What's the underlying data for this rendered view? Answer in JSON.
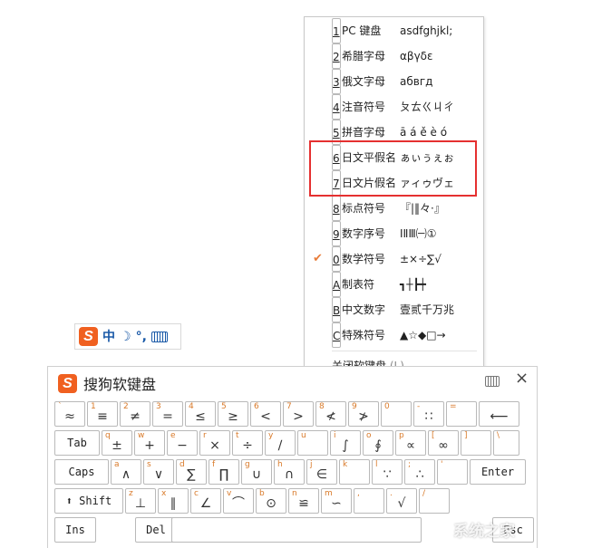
{
  "menu": {
    "items": [
      {
        "key": "1",
        "label": "PC 键盘",
        "sample": "asdfghjkl;",
        "checked": false
      },
      {
        "key": "2",
        "label": "希腊字母",
        "sample": "αβγδε",
        "checked": false
      },
      {
        "key": "3",
        "label": "俄文字母",
        "sample": "абвгд",
        "checked": false
      },
      {
        "key": "4",
        "label": "注音符号",
        "sample": "ㄆㄊㄍㄐㄔ",
        "checked": false
      },
      {
        "key": "5",
        "label": "拼音字母",
        "sample": "ā á ě è ó",
        "checked": false
      },
      {
        "key": "6",
        "label": "日文平假名",
        "sample": "ぁぃぅぇぉ",
        "checked": false
      },
      {
        "key": "7",
        "label": "日文片假名",
        "sample": "ァィゥヴェ",
        "checked": false
      },
      {
        "key": "8",
        "label": "标点符号",
        "sample": "『|‖々·』",
        "checked": false
      },
      {
        "key": "9",
        "label": "数字序号",
        "sample": "ⅠⅡⅢ㈠①",
        "checked": false
      },
      {
        "key": "0",
        "label": "数学符号",
        "sample": "±×÷∑√",
        "checked": true
      },
      {
        "key": "A",
        "label": "制表符",
        "sample": "┓┼┣┿",
        "checked": false
      },
      {
        "key": "B",
        "label": "中文数字",
        "sample": "壹贰千万兆",
        "checked": false
      },
      {
        "key": "C",
        "label": "特殊符号",
        "sample": "▲☆◆□→",
        "checked": false
      }
    ],
    "close_label": "关闭软键盘",
    "close_shortcut": "(L)",
    "check_mark": "✔"
  },
  "status_bar": {
    "logo": "S",
    "mode": "中",
    "moon": "☽",
    "punct": "°,"
  },
  "keyboard": {
    "logo": "S",
    "title": "搜狗软键盘",
    "close": "×",
    "rows": [
      [
        {
          "u": "`",
          "m": "≈"
        },
        {
          "u": "1",
          "m": "≡"
        },
        {
          "u": "2",
          "m": "≠"
        },
        {
          "u": "3",
          "m": "="
        },
        {
          "u": "4",
          "m": "≤"
        },
        {
          "u": "5",
          "m": "≥"
        },
        {
          "u": "6",
          "m": "<"
        },
        {
          "u": "7",
          "m": ">"
        },
        {
          "u": "8",
          "m": "≮"
        },
        {
          "u": "9",
          "m": "≯"
        },
        {
          "u": "0",
          "m": ""
        },
        {
          "u": "-",
          "m": "∷"
        },
        {
          "u": "=",
          "m": ""
        },
        {
          "u": "",
          "m": "⟵"
        }
      ],
      [
        {
          "u": "",
          "m": "Tab",
          "lbl": true
        },
        {
          "u": "q",
          "m": "±"
        },
        {
          "u": "w",
          "m": "+"
        },
        {
          "u": "e",
          "m": "−"
        },
        {
          "u": "r",
          "m": "×"
        },
        {
          "u": "t",
          "m": "÷"
        },
        {
          "u": "y",
          "m": "∕"
        },
        {
          "u": "u",
          "m": ""
        },
        {
          "u": "i",
          "m": "∫"
        },
        {
          "u": "o",
          "m": "∮"
        },
        {
          "u": "p",
          "m": "∝"
        },
        {
          "u": "[",
          "m": "∞"
        },
        {
          "u": "]",
          "m": ""
        },
        {
          "u": "\\",
          "m": ""
        }
      ],
      [
        {
          "u": "",
          "m": "Caps",
          "lbl": true
        },
        {
          "u": "a",
          "m": "∧"
        },
        {
          "u": "s",
          "m": "∨"
        },
        {
          "u": "d",
          "m": "∑"
        },
        {
          "u": "f",
          "m": "∏"
        },
        {
          "u": "g",
          "m": "∪"
        },
        {
          "u": "h",
          "m": "∩"
        },
        {
          "u": "j",
          "m": "∈"
        },
        {
          "u": "k",
          "m": ""
        },
        {
          "u": "l",
          "m": "∵"
        },
        {
          "u": ";",
          "m": "∴"
        },
        {
          "u": "'",
          "m": ""
        },
        {
          "u": "",
          "m": "Enter",
          "lbl": true
        }
      ],
      [
        {
          "u": "",
          "m": "⬆ Shift",
          "lbl": true
        },
        {
          "u": "z",
          "m": "⊥"
        },
        {
          "u": "x",
          "m": "∥"
        },
        {
          "u": "c",
          "m": "∠"
        },
        {
          "u": "v",
          "m": "⌒"
        },
        {
          "u": "b",
          "m": "⊙"
        },
        {
          "u": "n",
          "m": "≌"
        },
        {
          "u": "m",
          "m": "∽"
        },
        {
          "u": ",",
          "m": ""
        },
        {
          "u": ".",
          "m": "√"
        },
        {
          "u": "/",
          "m": ""
        }
      ],
      [
        {
          "u": "",
          "m": "Ins",
          "lbl": true
        },
        {
          "u": "",
          "m": "Del",
          "lbl": true
        },
        {
          "u": "",
          "m": "",
          "lbl": true
        },
        {
          "u": "",
          "m": "Esc",
          "lbl": true
        }
      ]
    ]
  },
  "watermark": "系统之家"
}
